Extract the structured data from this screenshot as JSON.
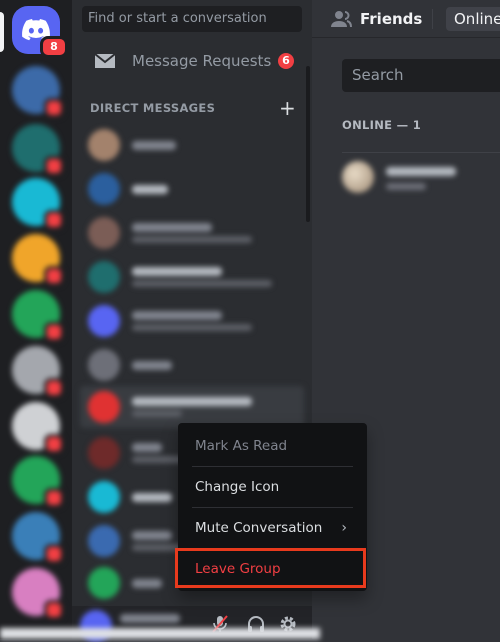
{
  "rail": {
    "home_badge": "8"
  },
  "sidebar": {
    "search_placeholder": "Find or start a conversation",
    "message_requests_label": "Message Requests",
    "message_requests_count": "6",
    "dm_header": "DIRECT MESSAGES",
    "add_dm_icon": "plus-icon"
  },
  "main": {
    "title": "Friends",
    "tab_online": "Online",
    "search_placeholder": "Search",
    "online_count": "ONLINE — 1"
  },
  "context_menu": {
    "items": [
      {
        "label": "Mark As Read",
        "disabled": true
      },
      {
        "label": "Change Icon"
      },
      {
        "label": "Mute Conversation",
        "submenu": true
      },
      {
        "label": "Leave Group",
        "danger": true
      }
    ]
  },
  "colors": {
    "blurple": "#5865f2",
    "danger": "#f23f43",
    "highlight": "#e83a1d"
  }
}
